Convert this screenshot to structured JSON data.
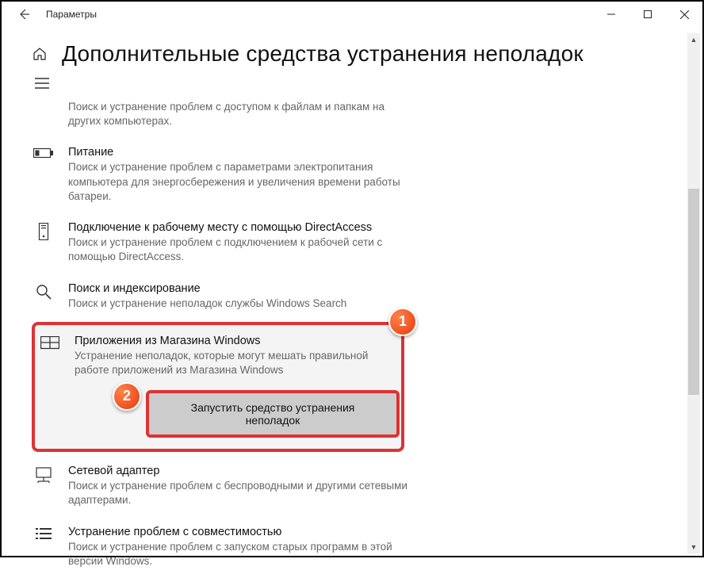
{
  "window": {
    "title": "Параметры"
  },
  "page": {
    "title": "Дополнительные средства устранения неполадок"
  },
  "items": {
    "partial": {
      "desc": "Поиск и устранение проблем с доступом к файлам и папкам на других компьютерах."
    },
    "power": {
      "title": "Питание",
      "desc": "Поиск и устранение проблем с параметрами электропитания компьютера для энергосбережения и увеличения времени работы батареи."
    },
    "directaccess": {
      "title": "Подключение к рабочему месту с помощью DirectAccess",
      "desc": "Поиск и устранение проблем с подключением к рабочей сети с помощью DirectAccess."
    },
    "search": {
      "title": "Поиск и индексирование",
      "desc": "Поиск и устранение неполадок службы Windows Search"
    },
    "store": {
      "title": "Приложения из Магазина Windows",
      "desc": "Устранение неполадок, которые могут мешать правильной работе приложений из Магазина Windows",
      "button": "Запустить средство устранения неполадок"
    },
    "network": {
      "title": "Сетевой адаптер",
      "desc": "Поиск и устранение проблем с беспроводными и другими сетевыми адаптерами."
    },
    "compat": {
      "title": "Устранение проблем с совместимостью",
      "desc": "Поиск и устранение проблем с запуском старых программ в этой версии Windows."
    }
  },
  "badges": {
    "one": "1",
    "two": "2"
  }
}
